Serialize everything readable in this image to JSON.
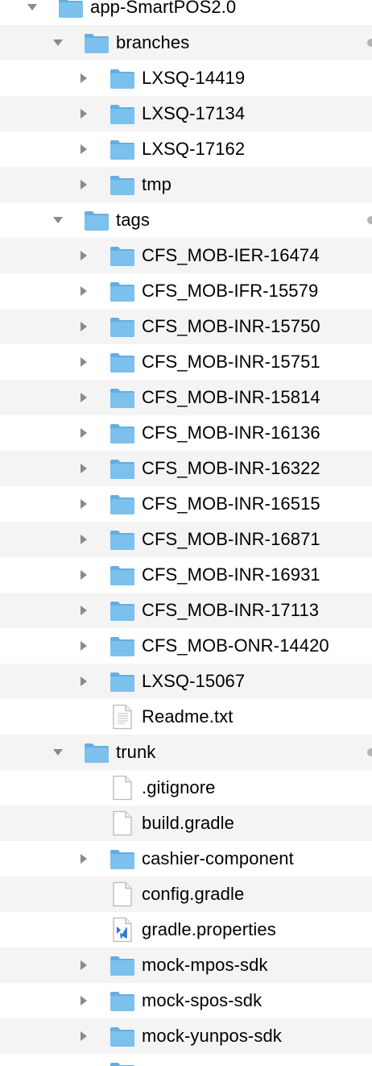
{
  "rows": [
    {
      "label": "app-SmartPOS2.0",
      "level": 0,
      "kind": "folder",
      "disclosure": "expanded",
      "stripe": "white",
      "edge_dot": false
    },
    {
      "label": "branches",
      "level": 1,
      "kind": "folder",
      "disclosure": "expanded",
      "stripe": "alt",
      "edge_dot": true
    },
    {
      "label": "LXSQ-14419",
      "level": 2,
      "kind": "folder",
      "disclosure": "collapsed",
      "stripe": "white",
      "edge_dot": false
    },
    {
      "label": "LXSQ-17134",
      "level": 2,
      "kind": "folder",
      "disclosure": "collapsed",
      "stripe": "alt",
      "edge_dot": false
    },
    {
      "label": "LXSQ-17162",
      "level": 2,
      "kind": "folder",
      "disclosure": "collapsed",
      "stripe": "white",
      "edge_dot": false
    },
    {
      "label": "tmp",
      "level": 2,
      "kind": "folder",
      "disclosure": "collapsed",
      "stripe": "alt",
      "edge_dot": false
    },
    {
      "label": "tags",
      "level": 1,
      "kind": "folder",
      "disclosure": "expanded",
      "stripe": "white",
      "edge_dot": true
    },
    {
      "label": "CFS_MOB-IER-16474",
      "level": 2,
      "kind": "folder",
      "disclosure": "collapsed",
      "stripe": "alt",
      "edge_dot": false
    },
    {
      "label": "CFS_MOB-IFR-15579",
      "level": 2,
      "kind": "folder",
      "disclosure": "collapsed",
      "stripe": "white",
      "edge_dot": false
    },
    {
      "label": "CFS_MOB-INR-15750",
      "level": 2,
      "kind": "folder",
      "disclosure": "collapsed",
      "stripe": "alt",
      "edge_dot": false
    },
    {
      "label": "CFS_MOB-INR-15751",
      "level": 2,
      "kind": "folder",
      "disclosure": "collapsed",
      "stripe": "white",
      "edge_dot": false
    },
    {
      "label": "CFS_MOB-INR-15814",
      "level": 2,
      "kind": "folder",
      "disclosure": "collapsed",
      "stripe": "alt",
      "edge_dot": false
    },
    {
      "label": "CFS_MOB-INR-16136",
      "level": 2,
      "kind": "folder",
      "disclosure": "collapsed",
      "stripe": "white",
      "edge_dot": false
    },
    {
      "label": "CFS_MOB-INR-16322",
      "level": 2,
      "kind": "folder",
      "disclosure": "collapsed",
      "stripe": "alt",
      "edge_dot": false
    },
    {
      "label": "CFS_MOB-INR-16515",
      "level": 2,
      "kind": "folder",
      "disclosure": "collapsed",
      "stripe": "white",
      "edge_dot": false
    },
    {
      "label": "CFS_MOB-INR-16871",
      "level": 2,
      "kind": "folder",
      "disclosure": "collapsed",
      "stripe": "alt",
      "edge_dot": false
    },
    {
      "label": "CFS_MOB-INR-16931",
      "level": 2,
      "kind": "folder",
      "disclosure": "collapsed",
      "stripe": "white",
      "edge_dot": false
    },
    {
      "label": "CFS_MOB-INR-17113",
      "level": 2,
      "kind": "folder",
      "disclosure": "collapsed",
      "stripe": "alt",
      "edge_dot": false
    },
    {
      "label": "CFS_MOB-ONR-14420",
      "level": 2,
      "kind": "folder",
      "disclosure": "collapsed",
      "stripe": "white",
      "edge_dot": false
    },
    {
      "label": "LXSQ-15067",
      "level": 2,
      "kind": "folder",
      "disclosure": "collapsed",
      "stripe": "alt",
      "edge_dot": false
    },
    {
      "label": "Readme.txt",
      "level": 2,
      "kind": "text-file",
      "disclosure": "none",
      "stripe": "white",
      "edge_dot": false
    },
    {
      "label": "trunk",
      "level": 1,
      "kind": "folder",
      "disclosure": "expanded",
      "stripe": "alt",
      "edge_dot": true
    },
    {
      "label": ".gitignore",
      "level": 2,
      "kind": "blank-file",
      "disclosure": "none",
      "stripe": "white",
      "edge_dot": false
    },
    {
      "label": "build.gradle",
      "level": 2,
      "kind": "blank-file",
      "disclosure": "none",
      "stripe": "alt",
      "edge_dot": false
    },
    {
      "label": "cashier-component",
      "level": 2,
      "kind": "folder",
      "disclosure": "collapsed",
      "stripe": "white",
      "edge_dot": false
    },
    {
      "label": "config.gradle",
      "level": 2,
      "kind": "blank-file",
      "disclosure": "none",
      "stripe": "alt",
      "edge_dot": false
    },
    {
      "label": "gradle.properties",
      "level": 2,
      "kind": "vscode-file",
      "disclosure": "none",
      "stripe": "white",
      "edge_dot": false
    },
    {
      "label": "mock-mpos-sdk",
      "level": 2,
      "kind": "folder",
      "disclosure": "collapsed",
      "stripe": "alt",
      "edge_dot": false
    },
    {
      "label": "mock-spos-sdk",
      "level": 2,
      "kind": "folder",
      "disclosure": "collapsed",
      "stripe": "white",
      "edge_dot": false
    },
    {
      "label": "mock-yunpos-sdk",
      "level": 2,
      "kind": "folder",
      "disclosure": "collapsed",
      "stripe": "alt",
      "edge_dot": false
    },
    {
      "label": "",
      "level": 2,
      "kind": "folder",
      "disclosure": "collapsed",
      "stripe": "white",
      "edge_dot": false
    }
  ],
  "colors": {
    "stripe": "#f4f4f4",
    "folder": "#7cc0ee",
    "folder_tab": "#64aee2",
    "disclosure": "#8a8a8a",
    "file_outline": "#b8b8b8",
    "vscode": "#2a7bd2"
  }
}
